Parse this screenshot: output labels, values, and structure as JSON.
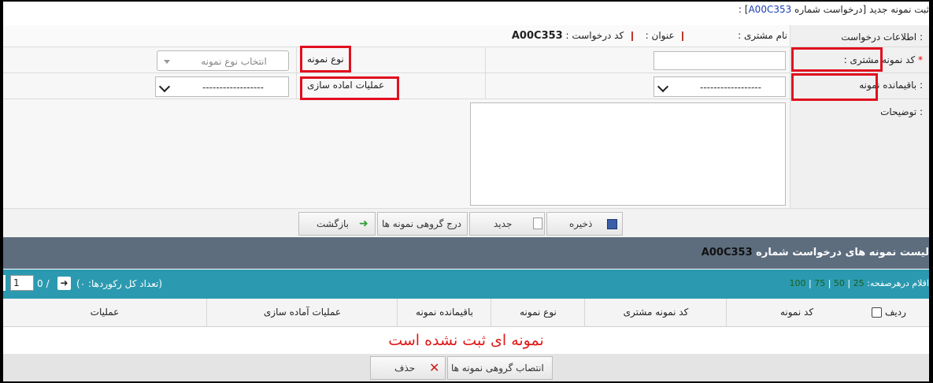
{
  "header": {
    "title_prefix": "ثبت نمونه جدید [درخواست شماره ",
    "request_link": "A00C353",
    "title_suffix": "] :"
  },
  "info_row": {
    "label": "اطلاعات درخواست :",
    "customer_name_label": "نام مشتری :",
    "customer_name_value": "",
    "subject_label": "عنوان :",
    "subject_value": "",
    "request_code_label": "کد درخواست :",
    "request_code_value": "A00C353"
  },
  "form": {
    "customer_sample_code_label": "کد نمونه مشتری :",
    "customer_sample_code_required": "*",
    "customer_sample_code_value": "",
    "sample_type_label": "نوع نمونه",
    "sample_type_placeholder": "انتخاب نوع نمونه",
    "sample_remainder_label": "باقیمانده نمونه :",
    "sample_remainder_value": "------------------",
    "prep_ops_label": "عملیات اماده سازی",
    "prep_ops_value": "------------------",
    "description_label": "توضیحات :",
    "description_value": ""
  },
  "actions": {
    "save": "ذخیره",
    "new": "جدید",
    "bulk_insert": "درج گروهی نمونه ها",
    "back": "بازگشت"
  },
  "list": {
    "title_text": "لیست نمونه های درخواست شماره",
    "title_code": "A00C353",
    "page_size_label": "اقلام درهرصفحه:",
    "page_sizes": [
      "25",
      "50",
      "75",
      "100"
    ],
    "total_records": "(تعداد کل رکوردها: ۰)",
    "page_current": "1",
    "page_separator": "/",
    "page_total": "0",
    "columns": {
      "row": "ردیف",
      "sample_code": "کد نمونه",
      "customer_sample_code": "کد نمونه مشتری",
      "sample_type": "نوع نمونه",
      "sample_remainder": "باقیمانده نمونه",
      "prep_ops": "عملیات آماده سازی",
      "operations": "عملیات"
    },
    "empty_message": "نمونه ای ثبت نشده است"
  },
  "bottom_actions": {
    "bulk_assign": "انتصاب گروهی نمونه ها",
    "delete": "حذف"
  },
  "colors": {
    "list_header_bg": "#5d6d7e",
    "grid_bar_bg": "#2b9ab0",
    "highlight_red": "#e0101e",
    "link_blue": "#1a3fb5"
  }
}
